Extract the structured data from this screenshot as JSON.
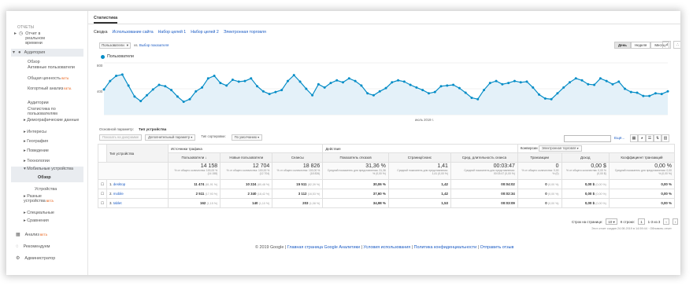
{
  "sidebar": {
    "reports_heading": "ОТЧЕТЫ",
    "realtime": "Отчет в реальном времени",
    "audience": "Аудитория",
    "items": [
      {
        "label": "Обзор"
      },
      {
        "label": "Активные пользователи"
      },
      {
        "label": "Общая ценность",
        "badge": "BETA"
      },
      {
        "label": "Когортный анализ",
        "badge": "BETA"
      },
      {
        "label": "Аудитории"
      },
      {
        "label": "Статистика по пользователям"
      },
      {
        "label": "Демографические данные"
      },
      {
        "label": "Интересы"
      },
      {
        "label": "География"
      },
      {
        "label": "Поведение"
      },
      {
        "label": "Технологии"
      },
      {
        "label": "Мобильные устройства"
      },
      {
        "label": "Обзор"
      },
      {
        "label": "Устройства"
      },
      {
        "label": "Разные устройства",
        "badge": "BETA"
      },
      {
        "label": "Специальные"
      },
      {
        "label": "Сравнения"
      }
    ],
    "bottom": [
      {
        "label": "Анализ",
        "badge": "BETA",
        "icon": "grid-icon"
      },
      {
        "label": "Рекомендуем",
        "icon": "bulb-icon"
      },
      {
        "label": "Администратор",
        "icon": "gear-icon"
      }
    ]
  },
  "tab_title": "Статистика",
  "subtabs": [
    "Сводка",
    "Использование сайта",
    "Набор целей 1",
    "Набор целей 2",
    "Электронная торговля"
  ],
  "segment": {
    "selector": "Пользователи",
    "add": "Выбор показателя"
  },
  "periods": [
    "День",
    "Неделя",
    "Месяц"
  ],
  "legend": "Пользователи",
  "chart_data": {
    "type": "line",
    "series": [
      {
        "name": "Пользователи",
        "values": [
          390,
          520,
          600,
          620,
          450,
          280,
          210,
          300,
          390,
          460,
          440,
          380,
          280,
          200,
          240,
          360,
          420,
          560,
          600,
          490,
          450,
          540,
          510,
          520,
          560,
          440,
          360,
          320,
          350,
          380,
          520,
          610,
          510,
          400,
          300,
          470,
          420,
          490,
          530,
          500,
          560,
          520,
          450,
          330,
          300,
          360,
          410,
          500,
          530,
          510,
          460,
          420,
          380,
          330,
          350,
          440,
          450,
          460,
          410,
          340,
          260,
          240,
          380,
          490,
          520,
          470,
          490,
          520,
          500,
          510,
          420,
          310,
          250,
          240,
          330,
          420,
          500,
          560,
          530,
          470,
          460,
          560,
          520,
          470,
          510,
          400,
          350,
          340,
          290,
          290,
          330,
          320,
          360
        ]
      }
    ],
    "xlabel": "",
    "ylabel": "",
    "ylim": [
      0,
      800
    ],
    "yticks": [
      "800",
      "400"
    ],
    "xtick": "июль 2019 г."
  },
  "dims": {
    "primary": "Основной параметр:",
    "value": "Тип устройства"
  },
  "toolbar": {
    "plot": "Показать на диаграмме",
    "secondary": "Дополнительный параметр",
    "sort": "Тип сортировки:",
    "default": "По умолчанию"
  },
  "search": {
    "placeholder": "",
    "advanced": "Ещё..."
  },
  "table": {
    "groups": {
      "traffic": "Источники трафика",
      "actions": "Действия",
      "conv": "Конверсии",
      "conv_select": "Электронная торговля"
    },
    "headers": [
      "Тип устройства",
      "Пользователи",
      "Новые пользователи",
      "Сеансы",
      "Показатель отказов",
      "Страниц/сеанс",
      "Сред. длительность сеанса",
      "Транзакции",
      "Доход",
      "Коэффициент транзакций"
    ],
    "totals": [
      {
        "value": "14 158",
        "sub": "% от общего количества: 100,00 % (14 158)"
      },
      {
        "value": "12 704",
        "sub": "% от общего количества: 100,00 % (12 704)"
      },
      {
        "value": "18 826",
        "sub": "% от общего количества: 100,00 % (18 826)"
      },
      {
        "value": "31,36 %",
        "sub": "Средний показатель для представления: 31,36 % (0,00 %)"
      },
      {
        "value": "1,41",
        "sub": "Средний показатель для представления: 1,41 (0,00 %)"
      },
      {
        "value": "00:03:47",
        "sub": "Средний показатель для представления: 00:03:47 (0,00 %)"
      },
      {
        "value": "0",
        "sub": "% от общего количества: 0,00 % (0)"
      },
      {
        "value": "0,00 $",
        "sub": "% от общего количества: 0,00 % (0,00 $)"
      },
      {
        "value": "0,00 %",
        "sub": "Средний показатель для представления: 0,00 % (0,00 %)"
      }
    ],
    "rows": [
      {
        "n": "1.",
        "name": "desktop",
        "c": [
          [
            "11 474",
            "(81,91 %)"
          ],
          [
            "10 224",
            "(80,48 %)"
          ],
          [
            "15 511",
            "(82,39 %)"
          ],
          [
            "30,06 %",
            ""
          ],
          [
            "1,42",
            ""
          ],
          [
            "00:04:02",
            ""
          ],
          [
            "0",
            "(0,00 %)"
          ],
          [
            "0,00 $",
            "(0,00 %)"
          ],
          [
            "0,00 %",
            ""
          ]
        ]
      },
      {
        "n": "2.",
        "name": "mobile",
        "c": [
          [
            "2 511",
            "(17,93 %)"
          ],
          [
            "2 340",
            "(18,42 %)"
          ],
          [
            "3 112",
            "(16,53 %)"
          ],
          [
            "37,60 %",
            ""
          ],
          [
            "1,42",
            ""
          ],
          [
            "00:02:34",
            ""
          ],
          [
            "0",
            "(0,00 %)"
          ],
          [
            "0,00 $",
            "(0,00 %)"
          ],
          [
            "0,00 %",
            ""
          ]
        ]
      },
      {
        "n": "3.",
        "name": "tablet",
        "c": [
          [
            "162",
            "(1,15 %)"
          ],
          [
            "140",
            "(1,10 %)"
          ],
          [
            "203",
            "(1,08 %)"
          ],
          [
            "34,98 %",
            ""
          ],
          [
            "1,53",
            ""
          ],
          [
            "00:03:09",
            ""
          ],
          [
            "0",
            "(0,00 %)"
          ],
          [
            "0,00 $",
            "(0,00 %)"
          ],
          [
            "0,00 %",
            ""
          ]
        ]
      }
    ]
  },
  "pager": {
    "rows_label": "Строк на странице:",
    "rows": "10",
    "goto": "К строке:",
    "goto_val": "1",
    "range": "1-3 из 3"
  },
  "report_time": "Этот отчет создан 24.08.2019 в 14:59:44 · Обновить отчет",
  "footer": {
    "copy": "© 2019 Google |",
    "links": [
      "Главная страница Google Аналитики",
      "Условия использования",
      "Политика конфиденциальности",
      "Отправить отзыв"
    ]
  }
}
